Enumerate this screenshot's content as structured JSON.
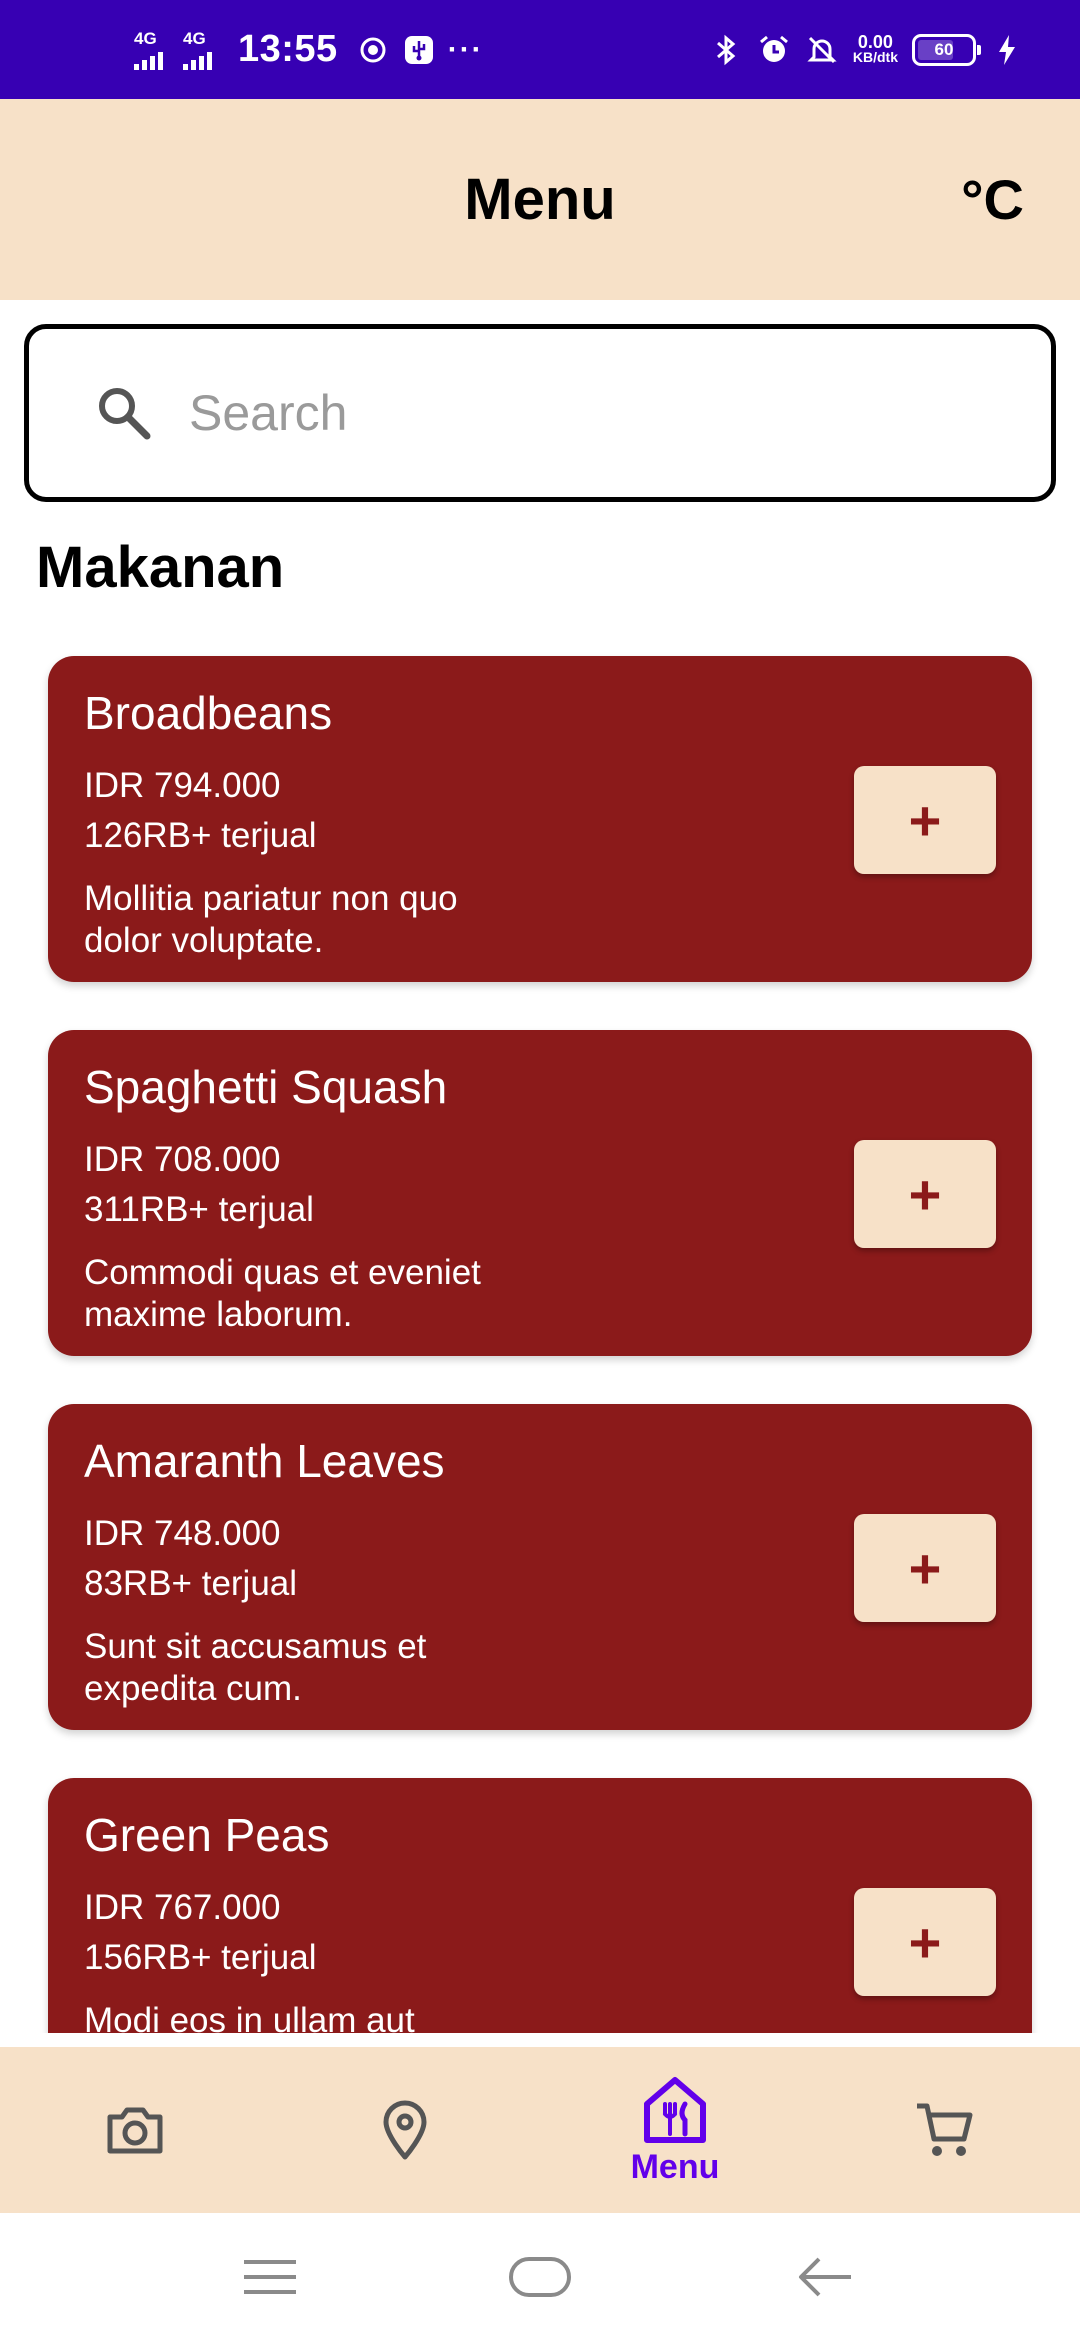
{
  "status_bar": {
    "signal1": "4G",
    "signal2": "4G",
    "time": "13:55",
    "more": "···",
    "net_speed_value": "0.00",
    "net_speed_unit": "KB/dtk",
    "battery_level": "60"
  },
  "app_bar": {
    "title": "Menu",
    "temperature_label": "°C"
  },
  "search": {
    "placeholder": "Search"
  },
  "section": {
    "title": "Makanan"
  },
  "items": [
    {
      "name": "Broadbeans",
      "price": "IDR 794.000",
      "sold": "126RB+ terjual",
      "description": "Mollitia pariatur non quo dolor voluptate.",
      "add_label": "+"
    },
    {
      "name": "Spaghetti Squash",
      "price": "IDR 708.000",
      "sold": "311RB+ terjual",
      "description": "Commodi quas et eveniet maxime laborum.",
      "add_label": "+"
    },
    {
      "name": "Amaranth Leaves",
      "price": "IDR 748.000",
      "sold": "83RB+ terjual",
      "description": "Sunt sit accusamus et expedita cum.",
      "add_label": "+"
    },
    {
      "name": "Green Peas",
      "price": "IDR 767.000",
      "sold": "156RB+ terjual",
      "description": "Modi eos in ullam aut",
      "add_label": "+"
    }
  ],
  "bottom_nav": {
    "items": [
      {
        "icon": "camera-icon",
        "label": ""
      },
      {
        "icon": "location-pin-icon",
        "label": ""
      },
      {
        "icon": "restaurant-menu-icon",
        "label": "Menu",
        "active": true
      },
      {
        "icon": "cart-icon",
        "label": ""
      }
    ]
  },
  "colors": {
    "status_bar": "#3700b3",
    "app_bar": "#f7e1c8",
    "card": "#8b1a1a",
    "accent": "#6200ea"
  }
}
